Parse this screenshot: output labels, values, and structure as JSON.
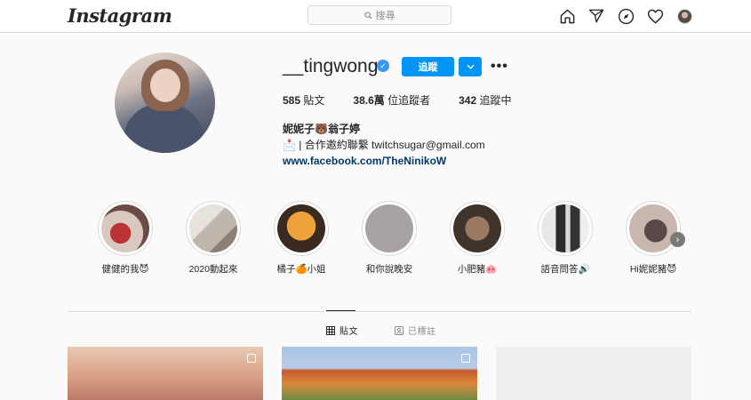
{
  "nav": {
    "logo": "Instagram",
    "search_placeholder": "搜尋",
    "icons": [
      "home-icon",
      "direct-icon",
      "explore-icon",
      "activity-heart-icon",
      "profile-avatar"
    ]
  },
  "profile": {
    "username": "__tingwong",
    "follow_label": "追蹤",
    "posts_count": "585",
    "posts_label": "貼文",
    "followers_count": "38.6萬",
    "followers_label": "位追蹤者",
    "following_count": "342",
    "following_label": "追蹤中",
    "display_name": "妮妮子🐻翁子婷",
    "bio_line": "📩 | 合作邀約聯繫 twitchsugar@gmail.com",
    "link": "www.facebook.com/TheNinikoW"
  },
  "highlights": [
    {
      "label": "健健的我😈"
    },
    {
      "label": "2020動起來"
    },
    {
      "label": "橘子🍊小姐"
    },
    {
      "label": "和你說晚安"
    },
    {
      "label": "小肥豬🐽"
    },
    {
      "label": "語音問答🔊"
    },
    {
      "label": "Hi妮妮豬😈"
    }
  ],
  "tabs": {
    "posts": "貼文",
    "tagged": "已標註"
  },
  "colors": {
    "accent": "#0095f6",
    "verified": "#3897f0",
    "link": "#00376b"
  }
}
